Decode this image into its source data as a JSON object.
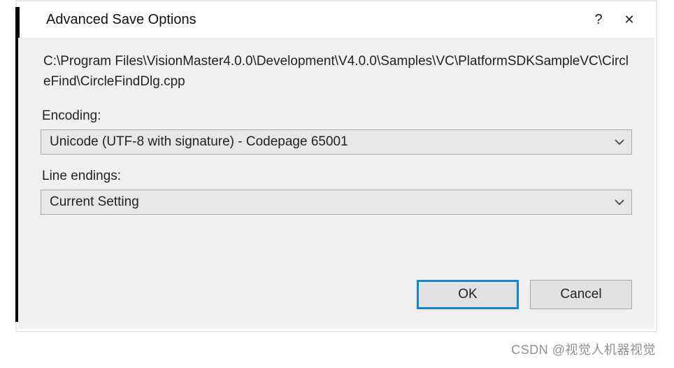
{
  "titlebar": {
    "title": "Advanced Save Options",
    "help_label": "?",
    "close_label": "✕"
  },
  "body": {
    "file_path": "C:\\Program Files\\VisionMaster4.0.0\\Development\\V4.0.0\\Samples\\VC\\PlatformSDKSampleVC\\CircleFind\\CircleFindDlg.cpp",
    "encoding_label": "Encoding:",
    "encoding_value": "Unicode (UTF-8 with signature) - Codepage 65001",
    "line_endings_label": "Line endings:",
    "line_endings_value": "Current Setting"
  },
  "buttons": {
    "ok": "OK",
    "cancel": "Cancel"
  },
  "watermark": "CSDN @视觉人机器视觉"
}
